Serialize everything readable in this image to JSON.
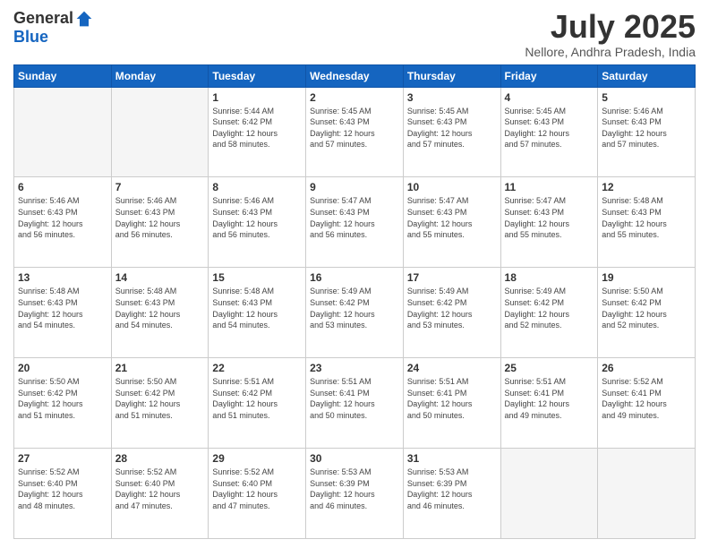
{
  "logo": {
    "general": "General",
    "blue": "Blue"
  },
  "title": "July 2025",
  "location": "Nellore, Andhra Pradesh, India",
  "days_header": [
    "Sunday",
    "Monday",
    "Tuesday",
    "Wednesday",
    "Thursday",
    "Friday",
    "Saturday"
  ],
  "weeks": [
    [
      {
        "day": "",
        "info": ""
      },
      {
        "day": "",
        "info": ""
      },
      {
        "day": "1",
        "info": "Sunrise: 5:44 AM\nSunset: 6:42 PM\nDaylight: 12 hours\nand 58 minutes."
      },
      {
        "day": "2",
        "info": "Sunrise: 5:45 AM\nSunset: 6:43 PM\nDaylight: 12 hours\nand 57 minutes."
      },
      {
        "day": "3",
        "info": "Sunrise: 5:45 AM\nSunset: 6:43 PM\nDaylight: 12 hours\nand 57 minutes."
      },
      {
        "day": "4",
        "info": "Sunrise: 5:45 AM\nSunset: 6:43 PM\nDaylight: 12 hours\nand 57 minutes."
      },
      {
        "day": "5",
        "info": "Sunrise: 5:46 AM\nSunset: 6:43 PM\nDaylight: 12 hours\nand 57 minutes."
      }
    ],
    [
      {
        "day": "6",
        "info": "Sunrise: 5:46 AM\nSunset: 6:43 PM\nDaylight: 12 hours\nand 56 minutes."
      },
      {
        "day": "7",
        "info": "Sunrise: 5:46 AM\nSunset: 6:43 PM\nDaylight: 12 hours\nand 56 minutes."
      },
      {
        "day": "8",
        "info": "Sunrise: 5:46 AM\nSunset: 6:43 PM\nDaylight: 12 hours\nand 56 minutes."
      },
      {
        "day": "9",
        "info": "Sunrise: 5:47 AM\nSunset: 6:43 PM\nDaylight: 12 hours\nand 56 minutes."
      },
      {
        "day": "10",
        "info": "Sunrise: 5:47 AM\nSunset: 6:43 PM\nDaylight: 12 hours\nand 55 minutes."
      },
      {
        "day": "11",
        "info": "Sunrise: 5:47 AM\nSunset: 6:43 PM\nDaylight: 12 hours\nand 55 minutes."
      },
      {
        "day": "12",
        "info": "Sunrise: 5:48 AM\nSunset: 6:43 PM\nDaylight: 12 hours\nand 55 minutes."
      }
    ],
    [
      {
        "day": "13",
        "info": "Sunrise: 5:48 AM\nSunset: 6:43 PM\nDaylight: 12 hours\nand 54 minutes."
      },
      {
        "day": "14",
        "info": "Sunrise: 5:48 AM\nSunset: 6:43 PM\nDaylight: 12 hours\nand 54 minutes."
      },
      {
        "day": "15",
        "info": "Sunrise: 5:48 AM\nSunset: 6:43 PM\nDaylight: 12 hours\nand 54 minutes."
      },
      {
        "day": "16",
        "info": "Sunrise: 5:49 AM\nSunset: 6:42 PM\nDaylight: 12 hours\nand 53 minutes."
      },
      {
        "day": "17",
        "info": "Sunrise: 5:49 AM\nSunset: 6:42 PM\nDaylight: 12 hours\nand 53 minutes."
      },
      {
        "day": "18",
        "info": "Sunrise: 5:49 AM\nSunset: 6:42 PM\nDaylight: 12 hours\nand 52 minutes."
      },
      {
        "day": "19",
        "info": "Sunrise: 5:50 AM\nSunset: 6:42 PM\nDaylight: 12 hours\nand 52 minutes."
      }
    ],
    [
      {
        "day": "20",
        "info": "Sunrise: 5:50 AM\nSunset: 6:42 PM\nDaylight: 12 hours\nand 51 minutes."
      },
      {
        "day": "21",
        "info": "Sunrise: 5:50 AM\nSunset: 6:42 PM\nDaylight: 12 hours\nand 51 minutes."
      },
      {
        "day": "22",
        "info": "Sunrise: 5:51 AM\nSunset: 6:42 PM\nDaylight: 12 hours\nand 51 minutes."
      },
      {
        "day": "23",
        "info": "Sunrise: 5:51 AM\nSunset: 6:41 PM\nDaylight: 12 hours\nand 50 minutes."
      },
      {
        "day": "24",
        "info": "Sunrise: 5:51 AM\nSunset: 6:41 PM\nDaylight: 12 hours\nand 50 minutes."
      },
      {
        "day": "25",
        "info": "Sunrise: 5:51 AM\nSunset: 6:41 PM\nDaylight: 12 hours\nand 49 minutes."
      },
      {
        "day": "26",
        "info": "Sunrise: 5:52 AM\nSunset: 6:41 PM\nDaylight: 12 hours\nand 49 minutes."
      }
    ],
    [
      {
        "day": "27",
        "info": "Sunrise: 5:52 AM\nSunset: 6:40 PM\nDaylight: 12 hours\nand 48 minutes."
      },
      {
        "day": "28",
        "info": "Sunrise: 5:52 AM\nSunset: 6:40 PM\nDaylight: 12 hours\nand 47 minutes."
      },
      {
        "day": "29",
        "info": "Sunrise: 5:52 AM\nSunset: 6:40 PM\nDaylight: 12 hours\nand 47 minutes."
      },
      {
        "day": "30",
        "info": "Sunrise: 5:53 AM\nSunset: 6:39 PM\nDaylight: 12 hours\nand 46 minutes."
      },
      {
        "day": "31",
        "info": "Sunrise: 5:53 AM\nSunset: 6:39 PM\nDaylight: 12 hours\nand 46 minutes."
      },
      {
        "day": "",
        "info": ""
      },
      {
        "day": "",
        "info": ""
      }
    ]
  ]
}
